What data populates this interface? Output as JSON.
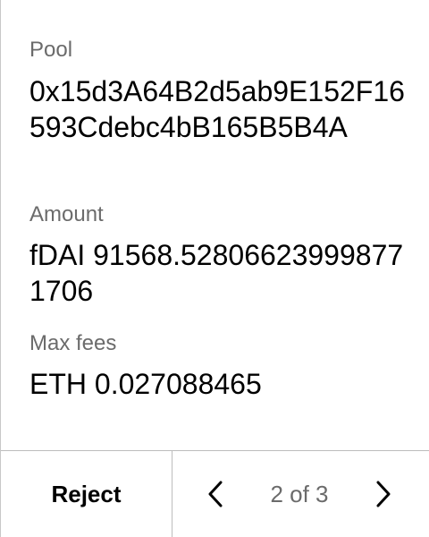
{
  "pool": {
    "label": "Pool",
    "value": "0x15d3A64B2d5ab9E152F16593Cdebc4bB165B5B4A"
  },
  "amount": {
    "label": "Amount",
    "value": "fDAI 91568.528066239998771706"
  },
  "max_fees": {
    "label": "Max fees",
    "value": "ETH 0.027088465"
  },
  "footer": {
    "reject_label": "Reject",
    "page_text": "2 of 3",
    "prev_icon": "chevron-left-icon",
    "next_icon": "chevron-right-icon"
  }
}
